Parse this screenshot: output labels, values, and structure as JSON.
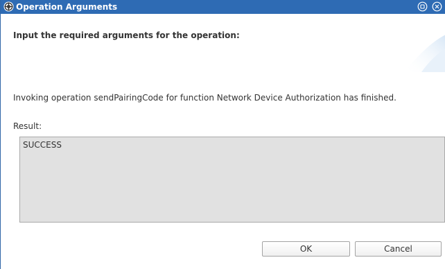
{
  "window": {
    "title": "Operation Arguments",
    "title_bar_color": "#2e6bb4",
    "icons": {
      "app": "gear-globe-icon",
      "restore": "restore-icon",
      "close": "close-icon"
    }
  },
  "header": {
    "instruction": "Input the required arguments for the operation:"
  },
  "body": {
    "status_message": "Invoking operation sendPairingCode for function Network Device Authorization has finished.",
    "result_label": "Result:",
    "result_value": "SUCCESS"
  },
  "buttons": {
    "ok_label": "OK",
    "cancel_label": "Cancel"
  }
}
